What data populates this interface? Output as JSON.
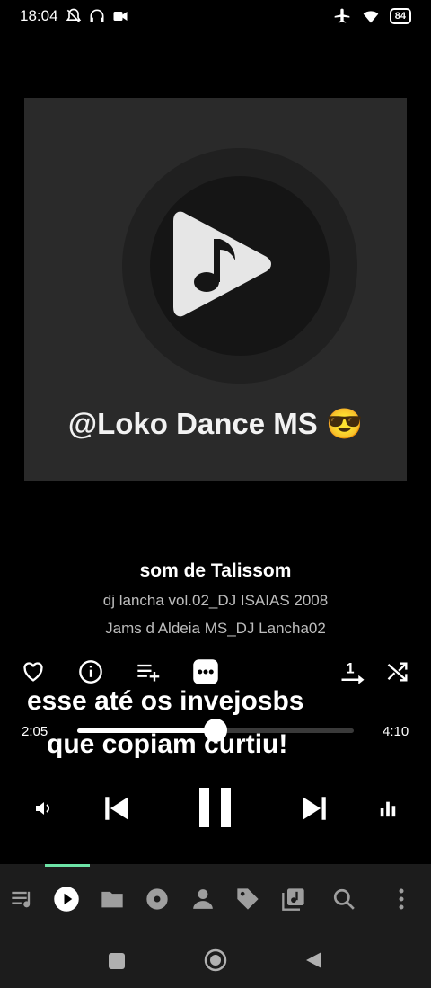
{
  "status": {
    "time": "18:04",
    "battery": "84",
    "left_icons": [
      "alarm-off-icon",
      "headphones-icon",
      "video-camera-icon"
    ],
    "right_icons": [
      "airplane-icon",
      "wifi-icon",
      "battery-icon"
    ]
  },
  "album_art": {
    "caption": "@Loko Dance MS 😎",
    "logo_icon": "play-note-logo-icon"
  },
  "track": {
    "title": "som de Talissom",
    "album": "dj lancha vol.02_DJ ISAIAS 2008",
    "artist": "Jams d Aldeia MS_DJ Lancha02"
  },
  "actions": [
    "favorite-icon",
    "info-icon",
    "add-to-playlist-icon",
    "more-icon",
    "repeat-one-icon",
    "shuffle-icon"
  ],
  "lyrics": {
    "line1": "esse até os invejosbs",
    "line2": "que copiam curtiu!"
  },
  "progress": {
    "elapsed": "2:05",
    "total": "4:10",
    "fraction": 0.5
  },
  "transport": [
    "volume-icon",
    "previous-icon",
    "pause-icon",
    "next-icon",
    "equalizer-icon"
  ],
  "nav": {
    "items": [
      "queue-icon",
      "now-playing-icon",
      "folder-icon",
      "album-icon",
      "artist-icon",
      "tag-icon",
      "library-icon",
      "search-icon",
      "overflow-menu-icon"
    ],
    "accent": "#6de3a6"
  },
  "colors": {
    "background": "#000000",
    "secondary_text": "#bdbdbd"
  }
}
